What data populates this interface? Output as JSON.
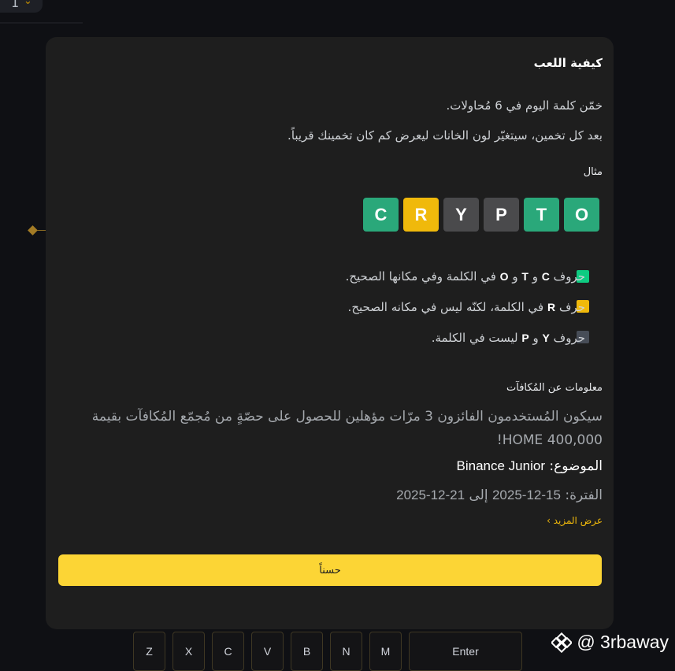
{
  "background": {
    "pill_text": "1",
    "chevron": "⌄"
  },
  "modal": {
    "title": "كيفية اللعب",
    "intro": "خمّن كلمة اليوم في 6 مُحاولات.",
    "explain": "بعد كل تخمين، سيتغيّر لون الخانات ليعرض كم كان تخمينك قريباً.",
    "example_label": "مثال",
    "tiles": [
      {
        "letter": "O",
        "color": "#2aa87a"
      },
      {
        "letter": "T",
        "color": "#2aa87a"
      },
      {
        "letter": "P",
        "color": "#4a4a4c"
      },
      {
        "letter": "Y",
        "color": "#4a4a4c"
      },
      {
        "letter": "R",
        "color": "#f0b90b"
      },
      {
        "letter": "C",
        "color": "#2aa87a"
      }
    ],
    "legend": {
      "green": {
        "color": "#0ecb81",
        "prefix": "حروف",
        "l1": "C",
        "and1": "و",
        "l2": "T",
        "and2": "و",
        "l3": "O",
        "suffix": "في الكلمة وفي مكانها الصحيح."
      },
      "yellow": {
        "color": "#f0b90b",
        "prefix": "حرف",
        "l1": "R",
        "suffix": "في الكلمة، لكنّه ليس في مكانه الصحيح."
      },
      "gray": {
        "color": "#474d57",
        "prefix": "حروف",
        "l1": "Y",
        "and1": "و",
        "l2": "P",
        "suffix": "ليست في الكلمة."
      }
    },
    "rewards_title": "معلومات عن المُكافآت",
    "rewards_text": "سيكون المُستخدمون الفائزون 3 مرّات مؤهلين للحصول على حصّةٍ من مُجمّع المُكافآت بقيمة 400,000 HOME!",
    "theme_label": "الموضوع:",
    "theme_value": "Binance Junior",
    "period_label": "الفترة:",
    "period_start": "2025-12-15",
    "period_to": "إلى",
    "period_end": "2025-12-21",
    "show_more": "عرض المزيد",
    "show_more_chevron": "›",
    "ok_button": "حسناً"
  },
  "keyboard": {
    "keys": [
      "Z",
      "X",
      "C",
      "V",
      "B",
      "N",
      "M"
    ],
    "enter": "Enter"
  },
  "watermark": {
    "text": "@ 3rbaway"
  }
}
